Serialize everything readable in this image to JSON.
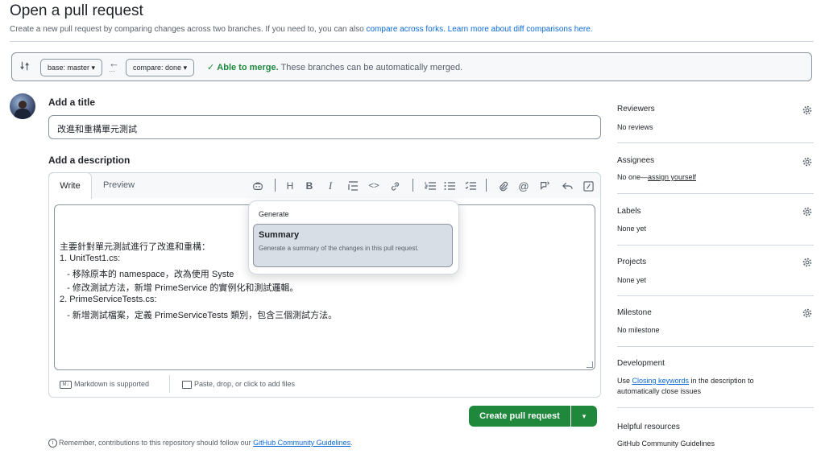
{
  "header": {
    "title": "Open a pull request",
    "subtitle_pre": "Create a new pull request by comparing changes across two branches. If you need to, you can also ",
    "compare_forks_link": "compare across forks.",
    "learn_more_link": "Learn more about diff comparisons here."
  },
  "compare_bar": {
    "base_label": "base: master",
    "compare_label": "compare: done",
    "merge_status": "Able to merge.",
    "merge_text": "These branches can be automatically merged."
  },
  "form": {
    "title_heading": "Add a title",
    "title_value": "改進和重構單元測試",
    "description_heading": "Add a description",
    "tabs": [
      "Write",
      "Preview"
    ],
    "description_lines": [
      "主要針對單元測試進行了改進和重構：",
      "1. UnitTest1.cs:",
      "   - 移除原本的 namespace，改為使用 Syste",
      "   - 修改測試方法，新增 PrimeService 的實例化和測試邏輯。",
      "2. PrimeServiceTests.cs:",
      "   - 新增測試檔案，定義 PrimeServiceTests 類別，包含三個測試方法。"
    ],
    "markdown_note": "Markdown is supported",
    "attach_note": "Paste, drop, or click to add files",
    "submit_label": "Create pull request",
    "footer_note_pre": "Remember, contributions to this repository should follow our ",
    "footer_note_link": "GitHub Community Guidelines",
    "footer_note_post": "."
  },
  "generate_popup": {
    "heading": "Generate",
    "item_title": "Summary",
    "item_desc": "Generate a summary of the changes in this pull request."
  },
  "sidebar": {
    "reviewers": {
      "label": "Reviewers",
      "value": "No reviews"
    },
    "assignees": {
      "label": "Assignees",
      "value_pre": "No one—",
      "value_link": "assign yourself"
    },
    "labels": {
      "label": "Labels",
      "value": "None yet"
    },
    "projects": {
      "label": "Projects",
      "value": "None yet"
    },
    "milestone": {
      "label": "Milestone",
      "value": "No milestone"
    },
    "development": {
      "label": "Development",
      "text_pre": "Use ",
      "text_link": "Closing keywords",
      "text_post": " in the description to automatically close issues"
    },
    "resources": {
      "label": "Helpful resources",
      "link": "GitHub Community Guidelines"
    }
  },
  "colors": {
    "accent": "#0969da",
    "success": "#1f883d",
    "border": "#d0d7de"
  }
}
